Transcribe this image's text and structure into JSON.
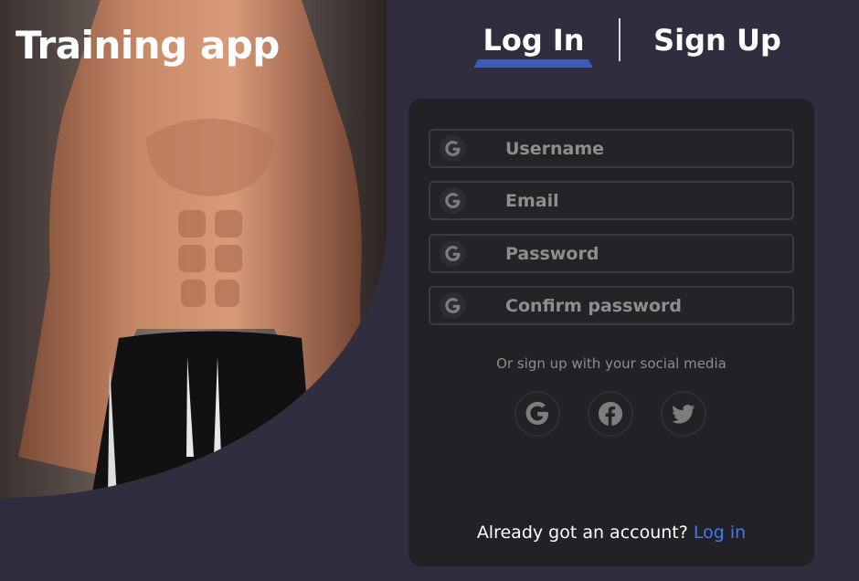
{
  "app": {
    "title": "Training app"
  },
  "tabs": [
    {
      "label": "Log In",
      "active": true
    },
    {
      "label": "Sign Up",
      "active": false
    }
  ],
  "form": {
    "fields": [
      {
        "icon": "google-icon",
        "placeholder": "Username",
        "value": ""
      },
      {
        "icon": "google-icon",
        "placeholder": "Email",
        "value": ""
      },
      {
        "icon": "google-icon",
        "placeholder": "Password",
        "value": ""
      },
      {
        "icon": "google-icon",
        "placeholder": "Confirm password",
        "value": ""
      }
    ],
    "social_prompt": "Or sign up with your social media",
    "social_buttons": [
      {
        "icon": "google-icon"
      },
      {
        "icon": "facebook-icon"
      },
      {
        "icon": "twitter-icon"
      }
    ],
    "footer_text": "Already got an account?",
    "footer_link": "Log in"
  },
  "colors": {
    "background": "#2f2d3e",
    "card": "#222126",
    "accent": "#3b5bb5",
    "link": "#3f7af5",
    "field_border": "#3c3b42",
    "icon_gray": "#7d7d7d"
  }
}
